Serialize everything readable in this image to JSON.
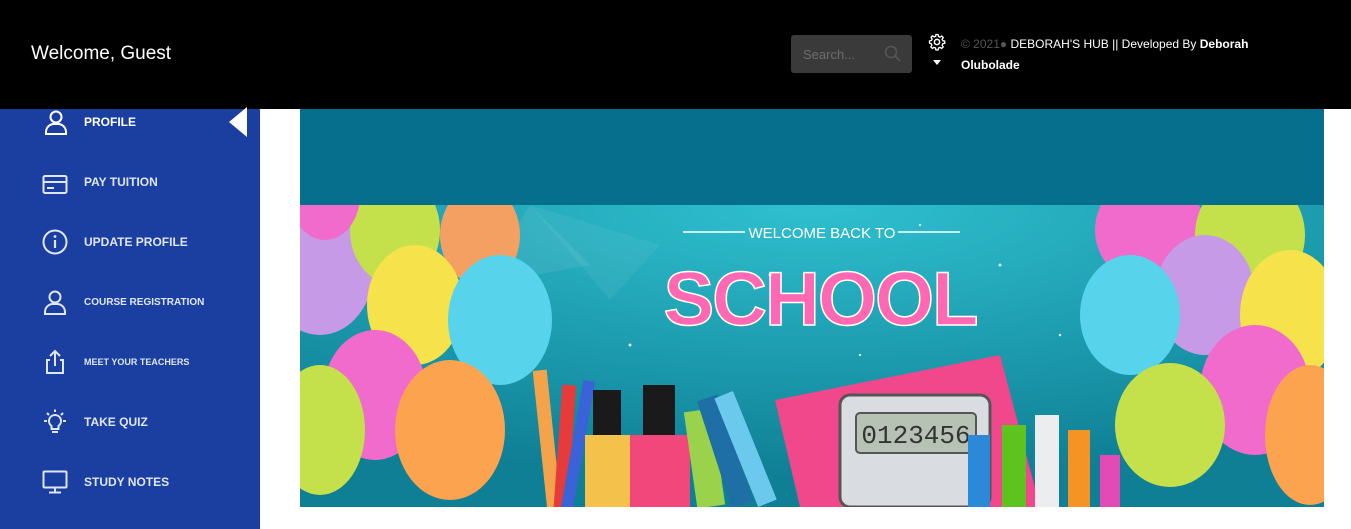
{
  "header": {
    "welcome_text": "Welcome, Guest",
    "search_placeholder": "Search...",
    "copyright_prefix": "© 2021",
    "copyright_hub": "DEBORAH'S HUB || Developed By",
    "developer_name": "Deborah Olubolade"
  },
  "sidebar": {
    "items": [
      {
        "label": "PROFILE",
        "icon": "user-icon",
        "active": true
      },
      {
        "label": "PAY TUITION",
        "icon": "credit-card-icon"
      },
      {
        "label": "UPDATE PROFILE",
        "icon": "info-icon"
      },
      {
        "label": "COURSE REGISTRATION",
        "icon": "user-icon"
      },
      {
        "label": "MEET YOUR TEACHERS",
        "icon": "share-icon"
      },
      {
        "label": "TAKE QUIZ",
        "icon": "lightbulb-icon"
      },
      {
        "label": "STUDY NOTES",
        "icon": "monitor-icon"
      }
    ]
  },
  "banner": {
    "subtitle": "WELCOME BACK TO",
    "title": "SCHOOL",
    "calculator_display": "0123456"
  },
  "colors": {
    "header_bg": "#000000",
    "sidebar_bg": "#1b3fa0",
    "teal_band": "#076f8e",
    "banner_bg": "#1aa4b8"
  }
}
